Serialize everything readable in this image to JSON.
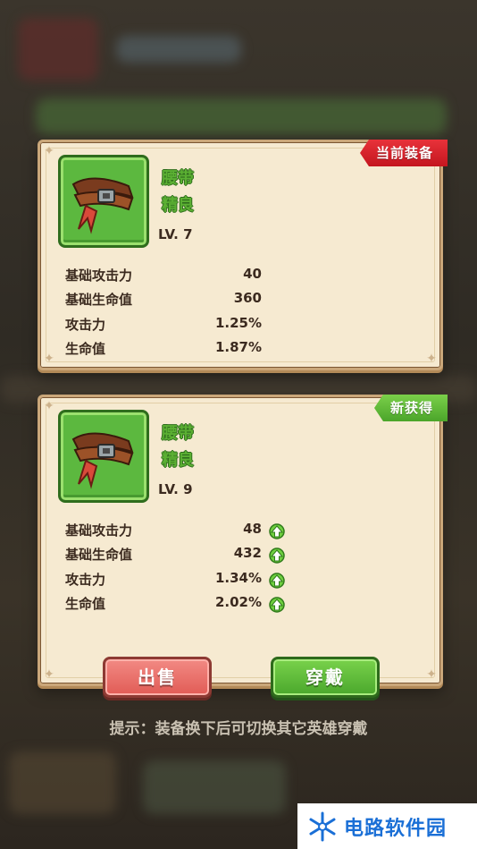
{
  "current_card": {
    "ribbon_label": "当前装备",
    "item_name": "腰带",
    "quality": "精良",
    "level": "LV. 7",
    "stats": [
      {
        "label": "基础攻击力",
        "value": "40"
      },
      {
        "label": "基础生命值",
        "value": "360"
      },
      {
        "label": "攻击力",
        "value": "1.25%"
      },
      {
        "label": "生命值",
        "value": "1.87%"
      }
    ]
  },
  "new_card": {
    "ribbon_label": "新获得",
    "item_name": "腰带",
    "quality": "精良",
    "level": "LV. 9",
    "stats": [
      {
        "label": "基础攻击力",
        "value": "48",
        "indicator": "up-arrow-icon"
      },
      {
        "label": "基础生命值",
        "value": "432",
        "indicator": "up-arrow-icon"
      },
      {
        "label": "攻击力",
        "value": "1.34%",
        "indicator": "up-arrow-icon"
      },
      {
        "label": "生命值",
        "value": "2.02%",
        "indicator": "up-arrow-icon"
      }
    ],
    "sell_label": "出售",
    "equip_label": "穿戴"
  },
  "hint": "提示：装备换下后可切换其它英雄穿戴",
  "watermark": {
    "text": "电路软件园",
    "icon": "snowflake-logo-icon"
  },
  "colors": {
    "current_ribbon": "#d41c24",
    "new_ribbon": "#5bb033",
    "quality_green": "#5bb033",
    "sell_button": "#e8706a",
    "equip_button": "#5cb83f"
  }
}
